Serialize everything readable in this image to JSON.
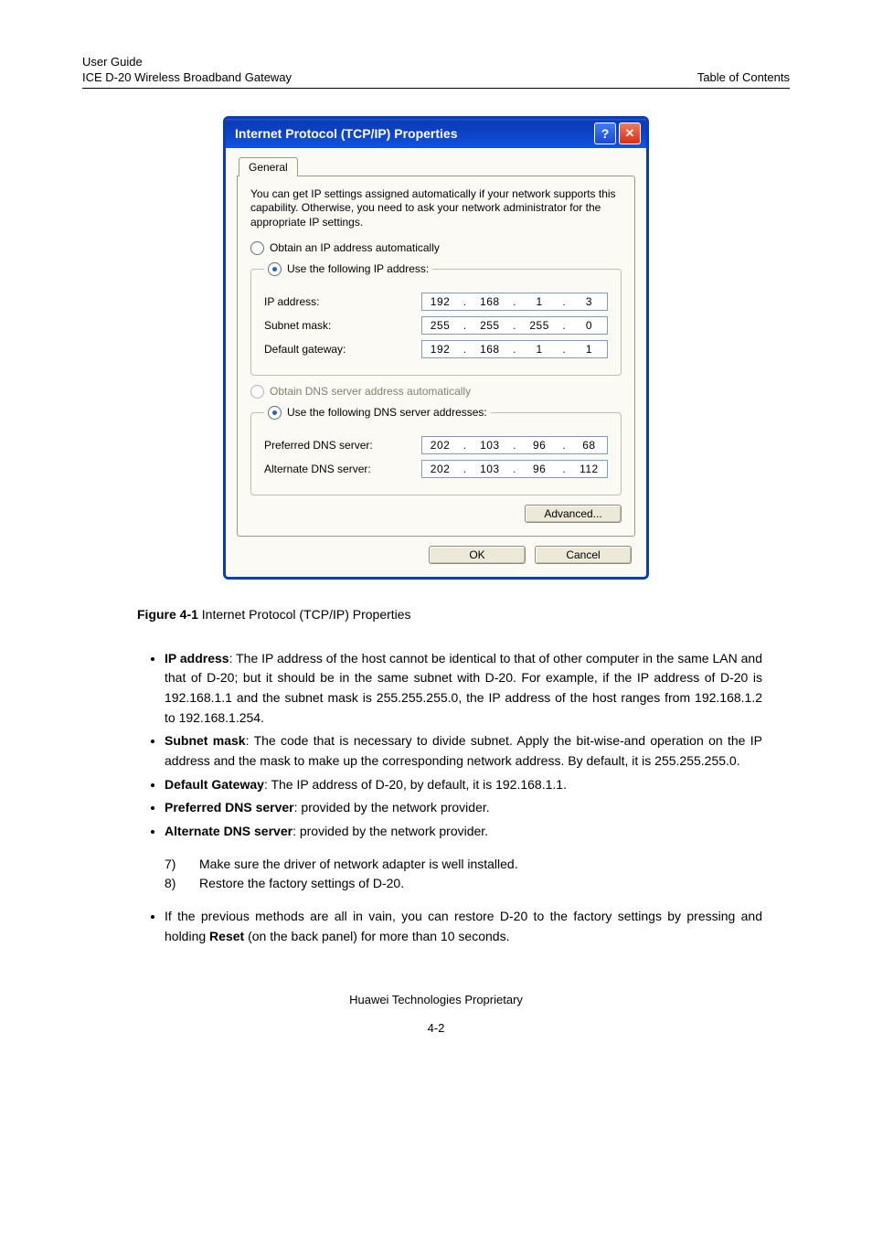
{
  "header": {
    "left_line1": "User Guide",
    "left_line2": "ICE D-20 Wireless Broadband Gateway",
    "right": "Table of Contents"
  },
  "dialog": {
    "title": "Internet Protocol (TCP/IP) Properties",
    "tab_label": "General",
    "description": "You can get IP settings assigned automatically if your network supports this capability. Otherwise, you need to ask your network administrator for the appropriate IP settings.",
    "radio_obtain_ip": "Obtain an IP address automatically",
    "radio_use_ip": "Use the following IP address:",
    "ip_label": "IP address:",
    "ip_value": [
      "192",
      "168",
      "1",
      "3"
    ],
    "subnet_label": "Subnet mask:",
    "subnet_value": [
      "255",
      "255",
      "255",
      "0"
    ],
    "gateway_label": "Default gateway:",
    "gateway_value": [
      "192",
      "168",
      "1",
      "1"
    ],
    "radio_obtain_dns": "Obtain DNS server address automatically",
    "radio_use_dns": "Use the following DNS server addresses:",
    "pref_dns_label": "Preferred DNS server:",
    "pref_dns_value": [
      "202",
      "103",
      "96",
      "68"
    ],
    "alt_dns_label": "Alternate DNS server:",
    "alt_dns_value": [
      "202",
      "103",
      "96",
      "112"
    ],
    "advanced_btn": "Advanced...",
    "ok_btn": "OK",
    "cancel_btn": "Cancel"
  },
  "figure": {
    "label": "Figure 4-1",
    "caption": " Internet Protocol (TCP/IP) Properties"
  },
  "bullets": {
    "b1_strong": "IP address",
    "b1_text": ": The IP address of the host cannot be identical to that of other computer in the same LAN and that of D-20; but it should be in the same subnet with D-20. For example, if the IP address of D-20 is 192.168.1.1 and the subnet mask is 255.255.255.0, the IP address of the host ranges from 192.168.1.2 to 192.168.1.254.",
    "b2_strong": "Subnet mask",
    "b2_text": ": The code that is necessary to divide subnet. Apply the bit-wise-and operation on the IP address and the mask to make up the corresponding network address. By default, it is 255.255.255.0.",
    "b3_strong": "Default Gateway",
    "b3_text": ": The IP address of D-20, by default, it is 192.168.1.1.",
    "b4_strong": "Preferred DNS server",
    "b4_text": ": provided by the network provider.",
    "b5_strong": "Alternate DNS server",
    "b5_text": ": provided by the network provider."
  },
  "numbered": {
    "n7_num": "7)",
    "n7_text": "Make sure the driver of network adapter is well installed.",
    "n8_num": "8)",
    "n8_text": "Restore the factory settings of D-20."
  },
  "last_bullet_pre": "If the previous methods are all in vain, you can restore D-20 to the factory settings by pressing and holding ",
  "last_bullet_strong": "Reset",
  "last_bullet_post": " (on the back panel) for more than 10 seconds.",
  "footer": "Huawei Technologies Proprietary",
  "page_number": "4-2"
}
